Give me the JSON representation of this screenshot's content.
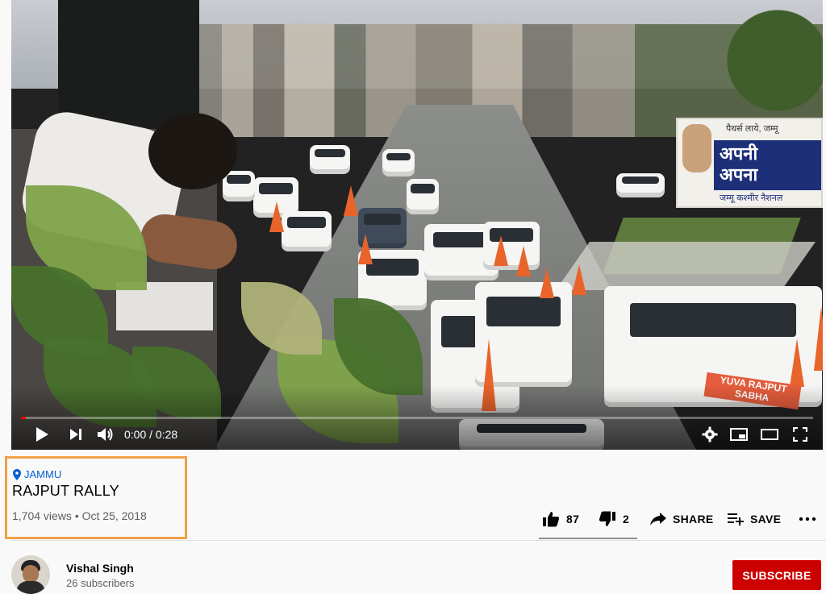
{
  "video": {
    "billboard_top": "पैथर्स लाये, जम्मू",
    "billboard_line1": "अपनी",
    "billboard_line2": "अपना",
    "billboard_bottom": "जम्मू कश्मीर नैशनल",
    "vehicle_plate": "YUVA RAJPUT SABHA",
    "progress_fraction": 0.0,
    "time_display": "0:00 / 0:28"
  },
  "meta": {
    "location": "JAMMU",
    "title": "RAJPUT RALLY",
    "stats": "1,704 views • Oct 25, 2018",
    "highlight_color": "#f0a048"
  },
  "actions": {
    "likes": "87",
    "dislikes": "2",
    "share": "SHARE",
    "save": "SAVE"
  },
  "channel": {
    "name": "Vishal Singh",
    "subscribers": "26 subscribers",
    "subscribe_label": "SUBSCRIBE",
    "subscribe_color": "#cc0000"
  },
  "icons": [
    "play-icon",
    "next-icon",
    "volume-icon",
    "settings-icon",
    "miniplayer-icon",
    "theater-icon",
    "fullscreen-icon",
    "location-pin-icon",
    "thumbs-up-icon",
    "thumbs-down-icon",
    "share-icon",
    "save-playlist-icon",
    "more-icon"
  ]
}
